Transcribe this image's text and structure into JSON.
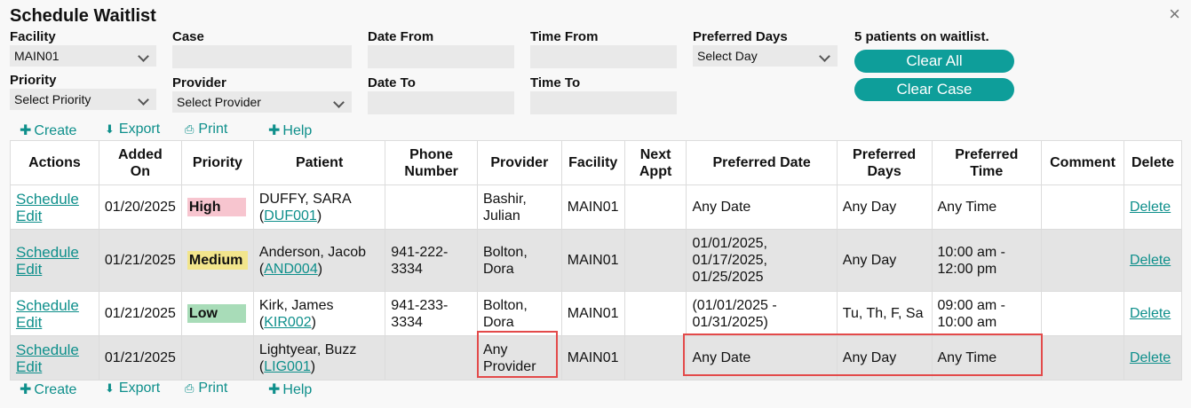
{
  "title": "Schedule Waitlist",
  "close_icon": "×",
  "filters": {
    "facility_label": "Facility",
    "facility_value": "MAIN01",
    "case_label": "Case",
    "case_value": "",
    "date_from_label": "Date From",
    "date_from_value": "",
    "time_from_label": "Time From",
    "time_from_value": "",
    "preferred_days_label": "Preferred Days",
    "preferred_days_value": "Select Day",
    "priority_label": "Priority",
    "priority_value": "Select Priority",
    "provider_label": "Provider",
    "provider_value": "Select Provider",
    "date_to_label": "Date To",
    "date_to_value": "",
    "time_to_label": "Time To",
    "time_to_value": ""
  },
  "waitlist_count": "5 patients on waitlist.",
  "buttons": {
    "clear_all": "Clear All",
    "clear_case": "Clear Case"
  },
  "toolbar": {
    "create": "Create",
    "export": "Export",
    "print": "Print",
    "help": "Help"
  },
  "table": {
    "headers": {
      "actions": "Actions",
      "added_on_1": "Added",
      "added_on_2": "On",
      "priority": "Priority",
      "patient": "Patient",
      "phone_1": "Phone",
      "phone_2": "Number",
      "provider": "Provider",
      "facility": "Facility",
      "next_1": "Next",
      "next_2": "Appt",
      "pref_date": "Preferred Date",
      "pref_days_1": "Preferred",
      "pref_days_2": "Days",
      "pref_time_1": "Preferred",
      "pref_time_2": "Time",
      "comment": "Comment",
      "delete": "Delete"
    },
    "rows": [
      {
        "schedule": "Schedule",
        "edit": "Edit",
        "added": "01/20/2025",
        "priority": "High",
        "patient_name": "DUFFY, SARA",
        "patient_id": "DUF001",
        "phone_1": "",
        "phone_2": "",
        "provider_1": "Bashir,",
        "provider_2": "Julian",
        "facility": "MAIN01",
        "next": "",
        "date_1": "Any Date",
        "date_2": "",
        "date_3": "",
        "days": "Any Day",
        "time_1": "Any Time",
        "time_2": "",
        "comment": "",
        "delete": "Delete"
      },
      {
        "schedule": "Schedule",
        "edit": "Edit",
        "added": "01/21/2025",
        "priority": "Medium",
        "patient_name": "Anderson, Jacob",
        "patient_id": "AND004",
        "phone_1": "941-222-",
        "phone_2": "3334",
        "provider_1": "Bolton,",
        "provider_2": "Dora",
        "facility": "MAIN01",
        "next": "",
        "date_1": "01/01/2025,",
        "date_2": "01/17/2025,",
        "date_3": "01/25/2025",
        "days": "Any Day",
        "time_1": "10:00 am -",
        "time_2": "12:00 pm",
        "comment": "",
        "delete": "Delete"
      },
      {
        "schedule": "Schedule",
        "edit": "Edit",
        "added": "01/21/2025",
        "priority": "Low",
        "patient_name": "Kirk, James",
        "patient_id": "KIR002",
        "phone_1": "941-233-",
        "phone_2": "3334",
        "provider_1": "Bolton,",
        "provider_2": "Dora",
        "facility": "MAIN01",
        "next": "",
        "date_1": "(01/01/2025 -",
        "date_2": "01/31/2025)",
        "date_3": "",
        "days": "Tu, Th, F, Sa",
        "time_1": "09:00 am -",
        "time_2": "10:00 am",
        "comment": "",
        "delete": "Delete"
      },
      {
        "schedule": "Schedule",
        "edit": "Edit",
        "added": "01/21/2025",
        "priority": "",
        "patient_name": "Lightyear, Buzz",
        "patient_id": "LIG001",
        "phone_1": "",
        "phone_2": "",
        "provider_1": "Any",
        "provider_2": "Provider",
        "facility": "MAIN01",
        "next": "",
        "date_1": "Any Date",
        "date_2": "",
        "date_3": "",
        "days": "Any Day",
        "time_1": "Any Time",
        "time_2": "",
        "comment": "",
        "delete": "Delete"
      }
    ]
  },
  "colors": {
    "accent": "#0e9e9a",
    "high": "#f7c5cf",
    "medium": "#f2e58c",
    "low": "#a8dcb8",
    "highlight": "#e34a4a"
  }
}
